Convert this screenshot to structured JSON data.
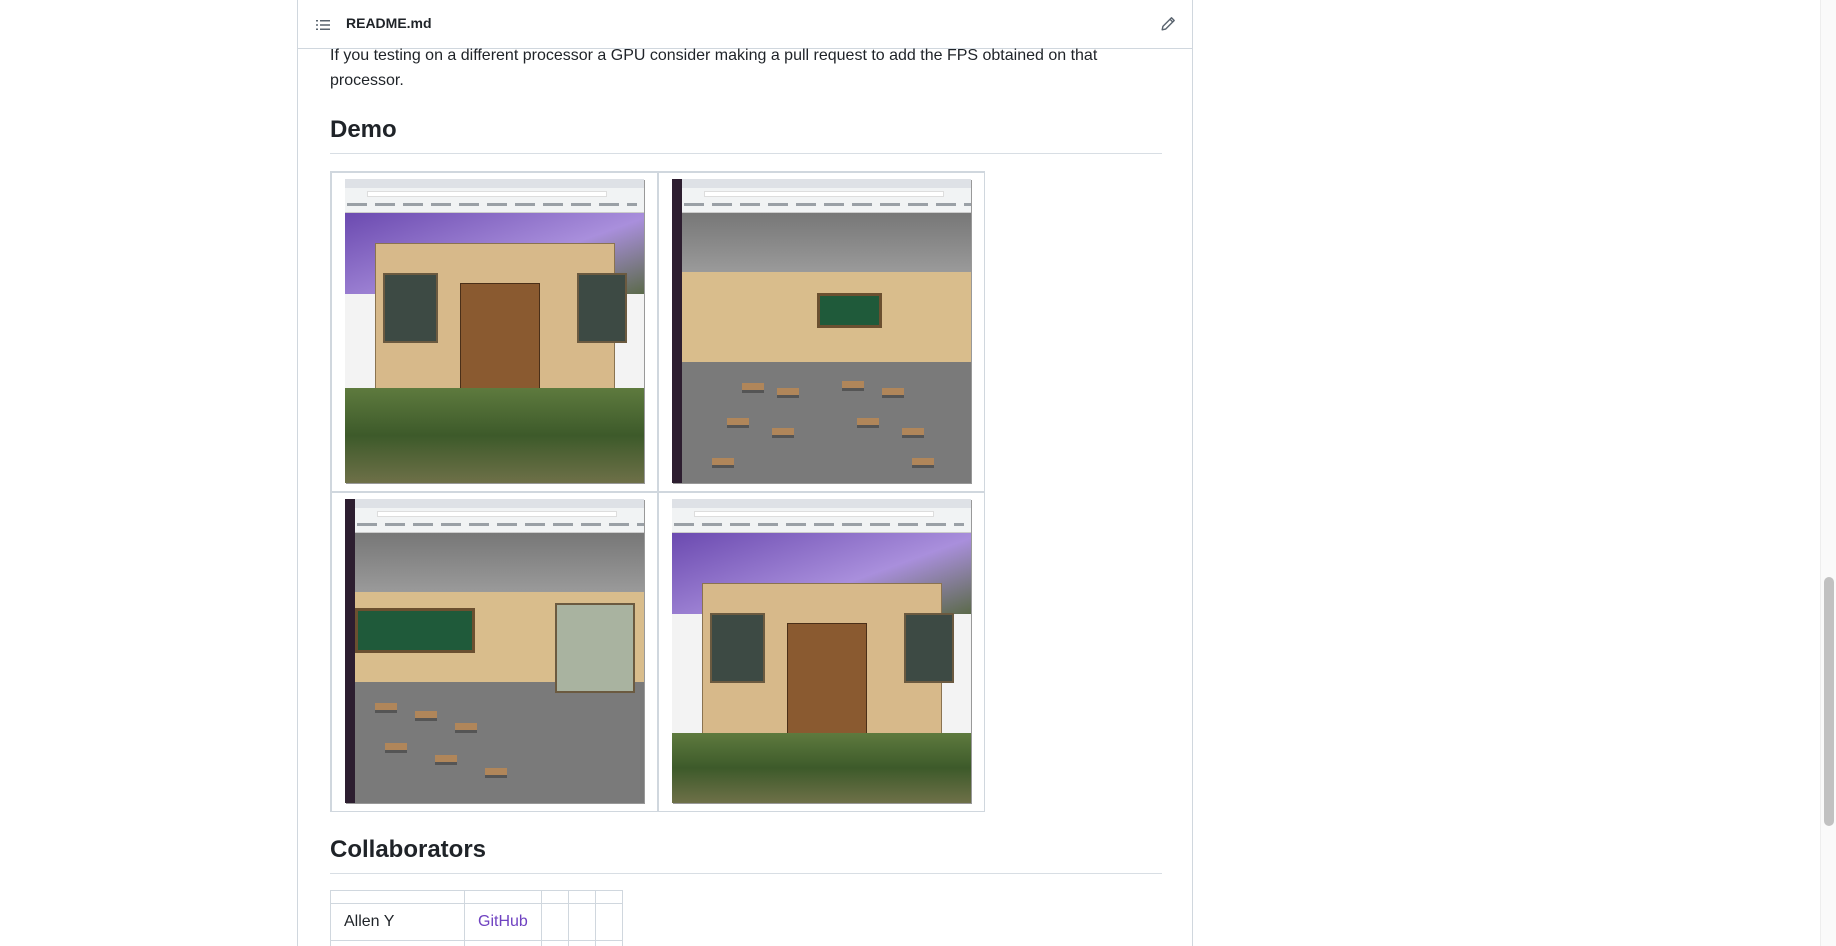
{
  "header": {
    "file_name": "README.md",
    "toc_icon": "list-unordered-icon",
    "edit_icon": "pencil-icon"
  },
  "content": {
    "intro_paragraph": "If you testing on a different processor a GPU consider making a pull request to add the FPS obtained on that processor.",
    "demo_heading": "Demo",
    "demo_images": [
      {
        "alt": "demo-screenshot-exterior-1"
      },
      {
        "alt": "demo-screenshot-classroom-1"
      },
      {
        "alt": "demo-screenshot-classroom-2"
      },
      {
        "alt": "demo-screenshot-exterior-2"
      }
    ],
    "collaborators_heading": "Collaborators",
    "collaborators": [
      {
        "name": "Allen Y",
        "link": "GitHub"
      }
    ]
  },
  "colors": {
    "link": "#6f42c1",
    "border": "#d0d7de",
    "text": "#1f2328"
  }
}
